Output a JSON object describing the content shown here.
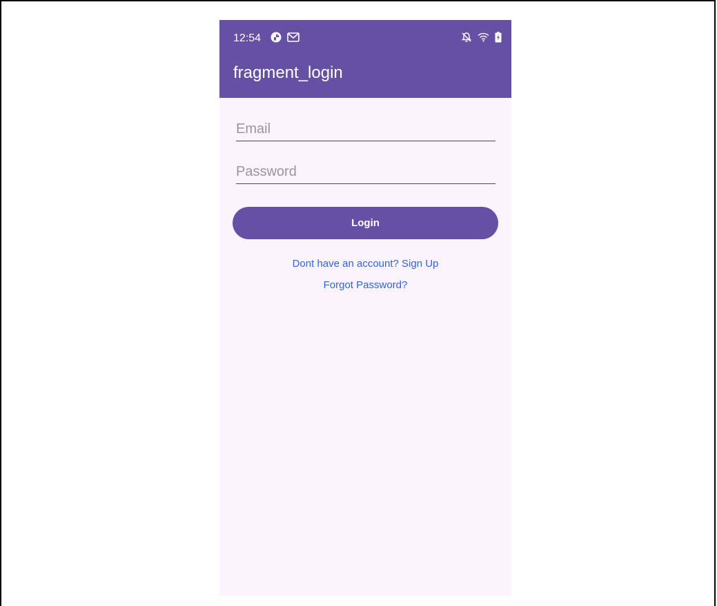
{
  "status_bar": {
    "time": "12:54",
    "left_icons": [
      "pinwheel-app-icon",
      "gmail-icon"
    ],
    "right_icons": [
      "notifications-off-icon",
      "wifi-icon",
      "battery-charging-icon"
    ]
  },
  "app_bar": {
    "title": "fragment_login"
  },
  "form": {
    "email": {
      "value": "",
      "placeholder": "Email"
    },
    "password": {
      "value": "",
      "placeholder": "Password"
    },
    "login_label": "Login"
  },
  "links": {
    "signup_label": "Dont have an account? Sign Up",
    "forgot_label": "Forgot Password?"
  },
  "colors": {
    "primary": "#6650a4",
    "background": "#fbf4fc",
    "link": "#2f63e8",
    "underline": "#4a4458"
  }
}
